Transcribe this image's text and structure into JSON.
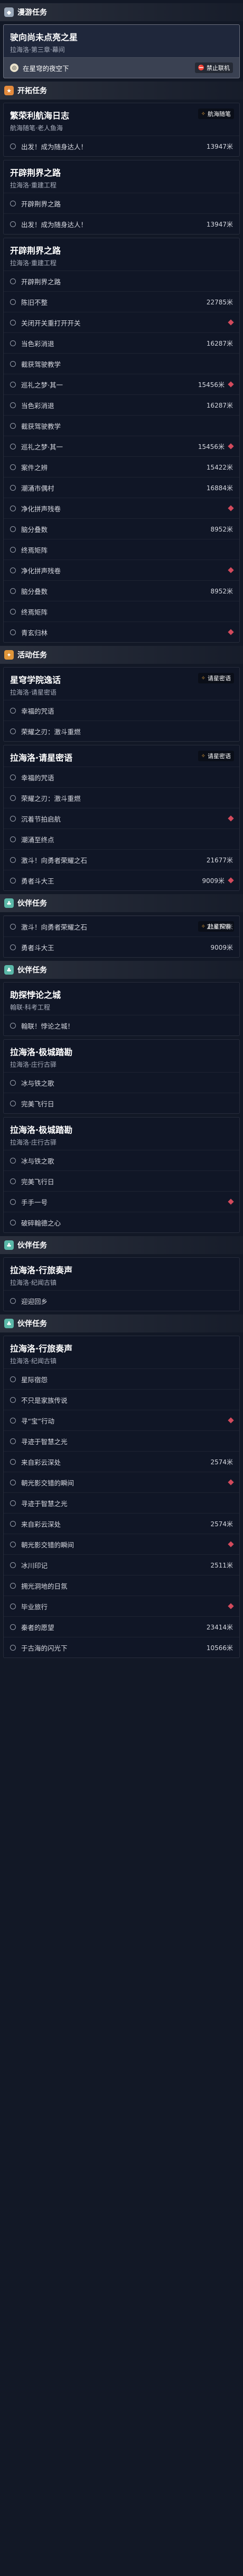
{
  "colors": {
    "side_quest": "#9aa7b8",
    "trailblaze": "#e48a3c",
    "event": "#e0963a",
    "companion": "#5ab8a8",
    "highlight": "#fff",
    "marker": "#d24a5c"
  },
  "categories": {
    "side": "漫游任务",
    "trail1": "开拓任务",
    "event": "活动任务",
    "companion1": "伙伴任务",
    "companion2": "伙伴任务",
    "companion3": "伙伴任务",
    "companion4": "伙伴任务"
  },
  "quests": {
    "q1": {
      "title": "驶向尚未点亮之星",
      "sub": "拉海洛·第三章·幕间",
      "obj": "在星穹的夜空下",
      "badge": "禁止联机"
    },
    "q2": {
      "title": "繁荣利航海日志",
      "sub": "航海随笔·老人鱼海",
      "badge": "航海随笔",
      "objs": [
        [
          "出发！成为随身达人！",
          "13947米"
        ]
      ]
    },
    "q3": {
      "title": "开辟荆界之路",
      "sub": "拉海洛·重建工程",
      "objs": [
        [
          "开辟荆界之路",
          ""
        ],
        [
          "出发！成为随身达人！",
          "13947米"
        ]
      ]
    },
    "q4": {
      "title": "开辟荆界之路",
      "sub": "拉海洛·重建工程",
      "objs": [
        [
          "开辟荆界之路",
          ""
        ],
        [
          "陈旧不整",
          "22785米"
        ],
        [
          "关闭开关重打开开关",
          ""
        ],
        [
          "当色彩消退",
          "16287米"
        ],
        [
          "截获驾驶教学",
          ""
        ],
        [
          "巡礼之梦·其一",
          "15456米"
        ],
        [
          "当色彩消退",
          "16287米"
        ],
        [
          "截获驾驶教学",
          ""
        ],
        [
          "巡礼之梦·其一",
          "15456米"
        ],
        [
          "案件之辨",
          "15422米"
        ],
        [
          "潮涌市偶村",
          "16884米"
        ],
        [
          "净化拼声残卷",
          ""
        ],
        [
          "脑分叠数",
          "8952米"
        ],
        [
          "终焉矩阵",
          ""
        ],
        [
          "净化拼声残卷",
          ""
        ],
        [
          "脑分叠数",
          "8952米"
        ],
        [
          "终焉矩阵",
          ""
        ],
        [
          "青玄归林",
          ""
        ]
      ]
    },
    "q5": {
      "title": "星穹学院逸话",
      "sub": "拉海洛·请星密语",
      "badge": "请星密语",
      "objs": [
        [
          "幸福的咒语",
          ""
        ],
        [
          "荣耀之刃：激斗重燃",
          ""
        ]
      ]
    },
    "q6": {
      "title": "拉海洛·请星密语",
      "sub": "",
      "badge": "请星密语",
      "objs": [
        [
          "幸福的咒语",
          ""
        ],
        [
          "荣耀之刃：激斗重燃",
          ""
        ],
        [
          "沉着节拍启航",
          ""
        ],
        [
          "潮涌至终点",
          ""
        ],
        [
          "激斗！向勇者荣耀之石",
          "21677米"
        ],
        [
          "勇者斗大王",
          "9009米"
        ]
      ]
    },
    "q7": {
      "title": "",
      "sub": "",
      "badge": "赴星探索",
      "objs": [
        [
          "激斗！向勇者荣耀之石",
          "21677米"
        ],
        [
          "勇者斗大王",
          "9009米"
        ]
      ]
    },
    "q8": {
      "title": "助探悖论之城",
      "sub": "翰联·科考工程",
      "objs": [
        [
          "翰联！悖论之城！",
          ""
        ]
      ]
    },
    "q9": {
      "title": "拉海洛·极城踏勘",
      "sub": "拉海洛·庄行古驿",
      "objs": [
        [
          "冰与铁之歌",
          ""
        ],
        [
          "完美飞行日",
          ""
        ]
      ]
    },
    "q10": {
      "title": "拉海洛·极城踏勘",
      "sub": "拉海洛·庄行古驿",
      "objs": [
        [
          "冰与铁之歌",
          ""
        ],
        [
          "完美飞行日",
          ""
        ],
        [
          "手手一号",
          ""
        ],
        [
          "破碎翰德之心",
          ""
        ]
      ]
    },
    "q11": {
      "title": "拉海洛·行旅奏声",
      "sub": "拉海洛·纪闻古镇",
      "objs": [
        [
          "迎迎回乡",
          ""
        ]
      ]
    },
    "q12": {
      "title": "拉海洛·行旅奏声",
      "sub": "拉海洛·纪闻古镇",
      "objs": [
        [
          "星际宿怨",
          ""
        ],
        [
          "不只是家族传说",
          ""
        ],
        [
          "寻“宝”行动",
          ""
        ],
        [
          "寻迹于智慧之光",
          ""
        ],
        [
          "来自彩云深处",
          "2574米"
        ],
        [
          "朝光影交错的瞬间",
          ""
        ],
        [
          "寻迹于智慧之光",
          ""
        ],
        [
          "来自彩云深处",
          "2574米"
        ],
        [
          "朝光影交错的瞬间",
          ""
        ],
        [
          "冰川印记",
          "2511米"
        ],
        [
          "拥光洞地的日氛",
          ""
        ],
        [
          "毕业旅行",
          ""
        ],
        [
          "秦者的愿望",
          "23414米"
        ],
        [
          "于古海的闪光下",
          "10566米"
        ]
      ]
    }
  }
}
